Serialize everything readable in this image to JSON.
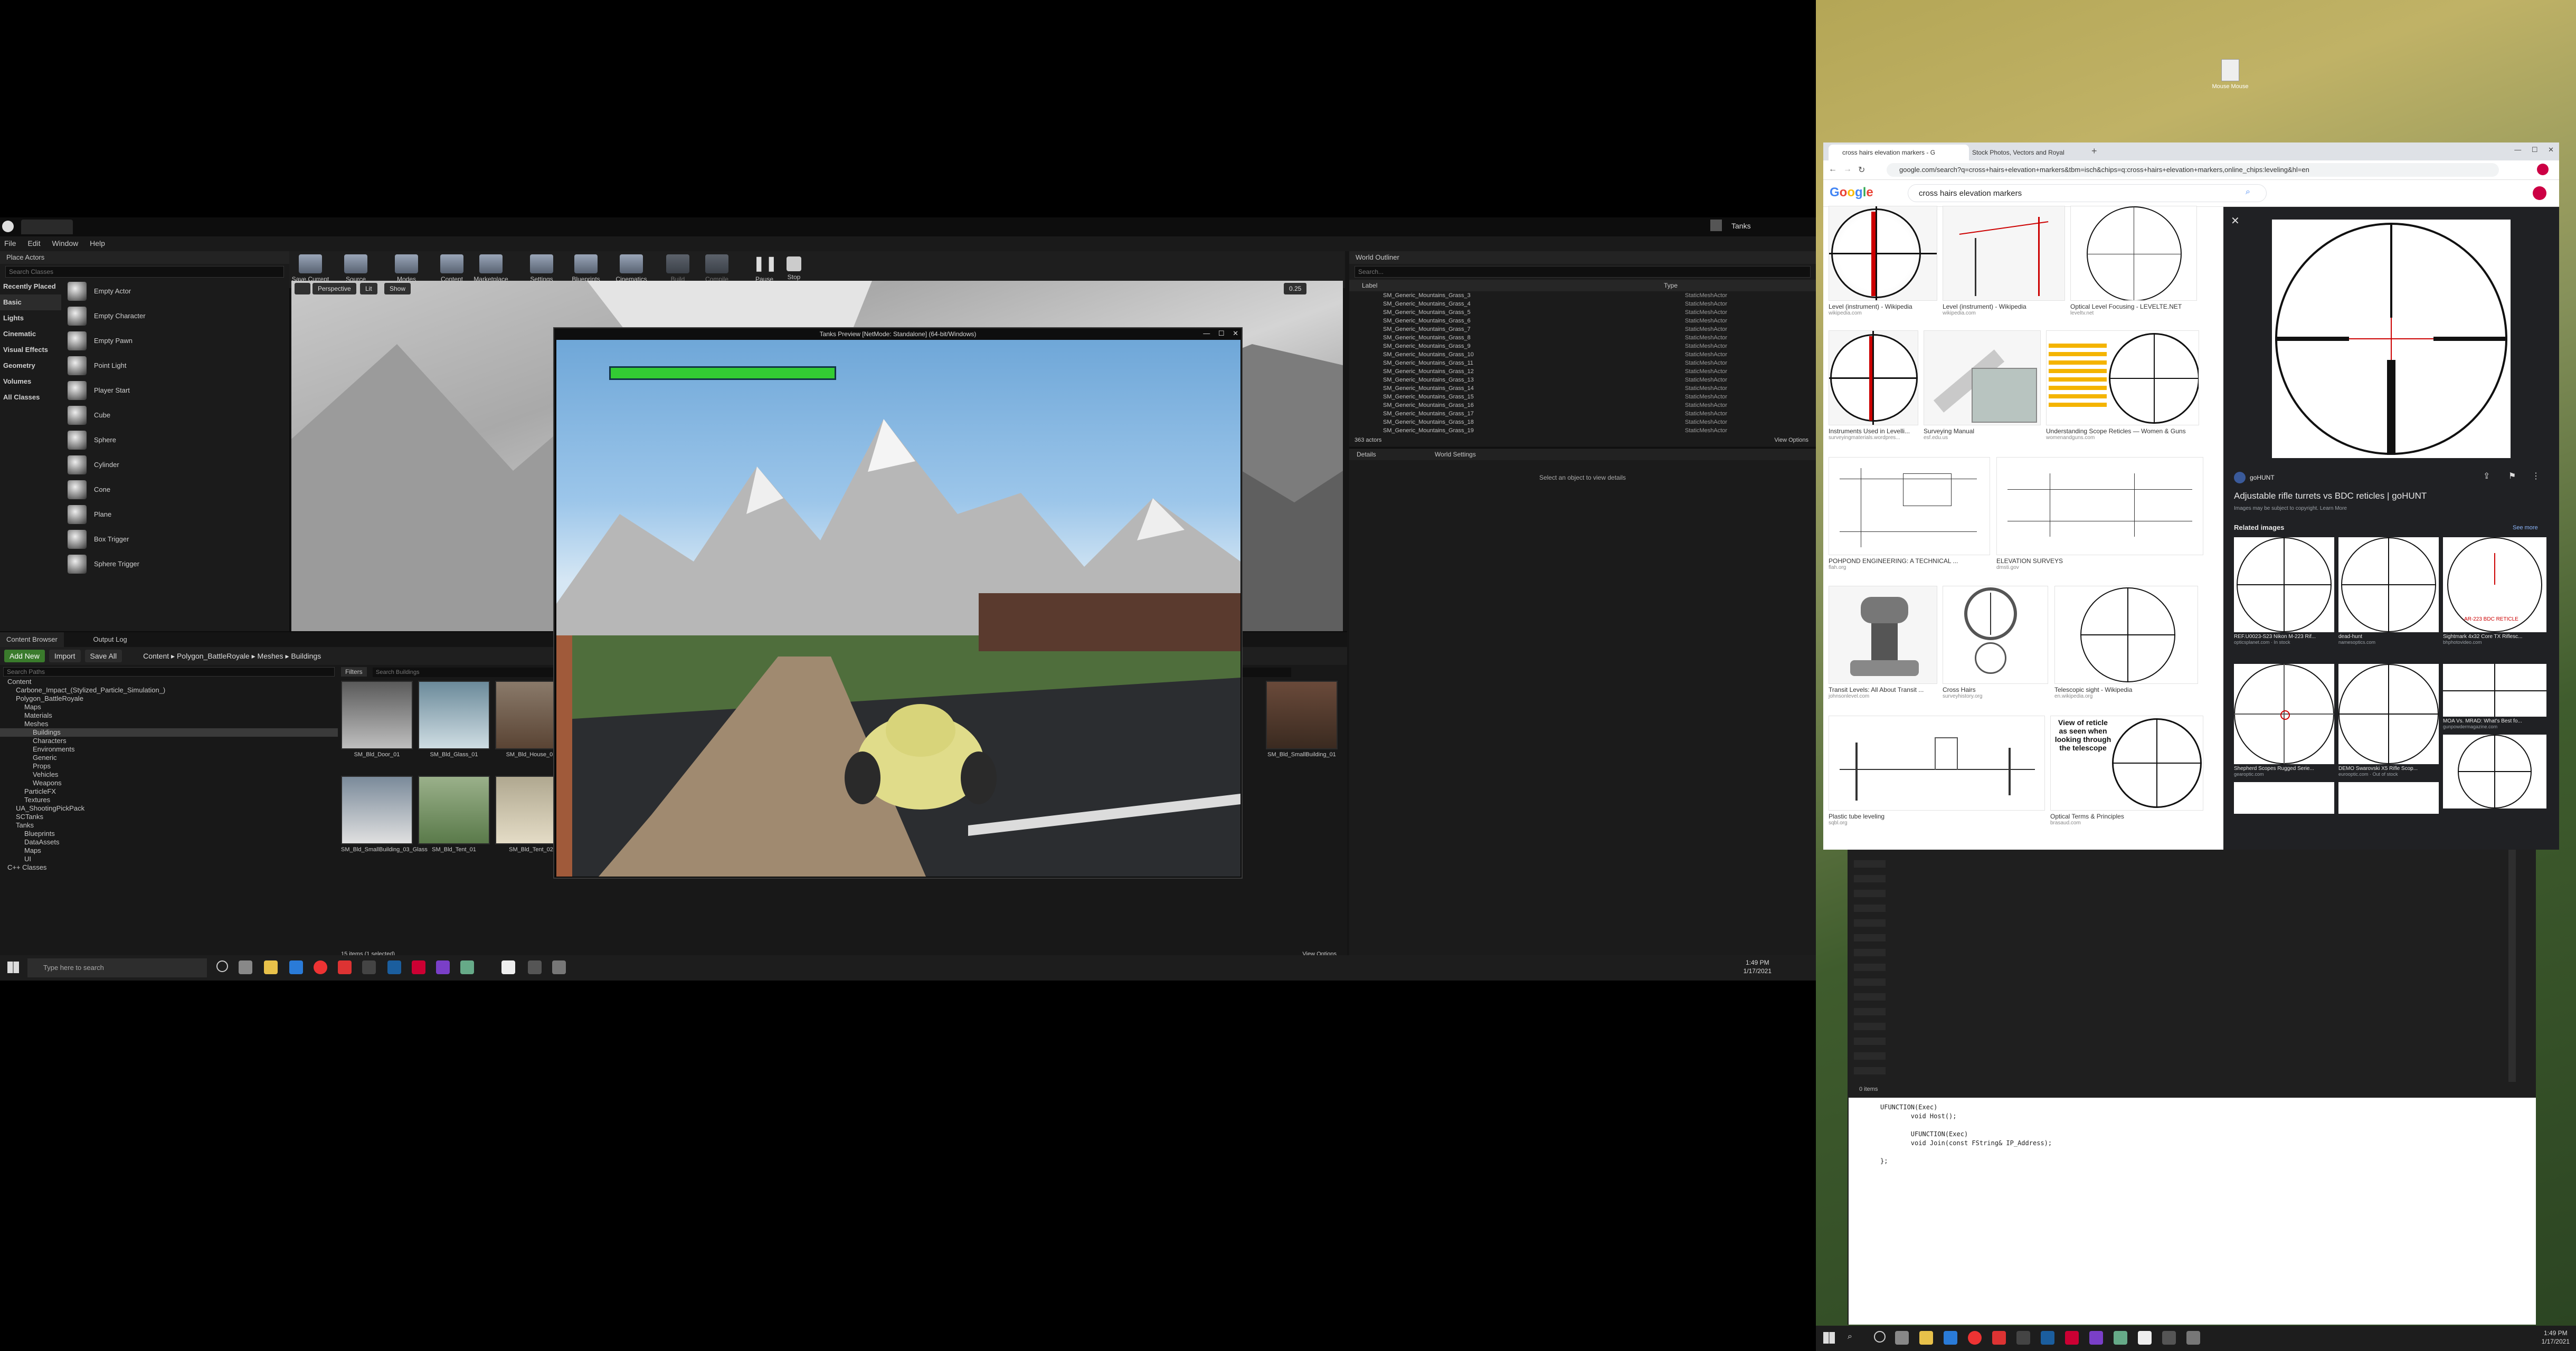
{
  "editor": {
    "title_tab": "Tanks",
    "project_tab": "Tanks",
    "menu": [
      "File",
      "Edit",
      "Window",
      "Help"
    ],
    "place_actors": {
      "header": "Place Actors",
      "search_placeholder": "Search Classes",
      "categories": [
        "Recently Placed",
        "Basic",
        "Lights",
        "Cinematic",
        "Visual Effects",
        "Geometry",
        "Volumes",
        "All Classes"
      ],
      "actors": [
        "Empty Actor",
        "Empty Character",
        "Empty Pawn",
        "Point Light",
        "Player Start",
        "Cube",
        "Sphere",
        "Cylinder",
        "Cone",
        "Plane",
        "Box Trigger",
        "Sphere Trigger"
      ]
    },
    "toolbar": [
      "Save Current",
      "Source Control",
      "Modes",
      "Content",
      "Marketplace",
      "Settings",
      "Blueprints",
      "Cinematics",
      "Build",
      "Compile",
      "Pause",
      "Stop"
    ],
    "viewport": {
      "perspective": "Perspective",
      "lit": "Lit",
      "show": "Show",
      "grid": "0.25"
    },
    "outliner": {
      "header": "World Outliner",
      "search_placeholder": "Search...",
      "col_label": "Label",
      "col_type": "Type",
      "rows": [
        "SM_Generic_Mountains_Grass_3",
        "SM_Generic_Mountains_Grass_4",
        "SM_Generic_Mountains_Grass_5",
        "SM_Generic_Mountains_Grass_6",
        "SM_Generic_Mountains_Grass_7",
        "SM_Generic_Mountains_Grass_8",
        "SM_Generic_Mountains_Grass_9",
        "SM_Generic_Mountains_Grass_10",
        "SM_Generic_Mountains_Grass_11",
        "SM_Generic_Mountains_Grass_12",
        "SM_Generic_Mountains_Grass_13",
        "SM_Generic_Mountains_Grass_14",
        "SM_Generic_Mountains_Grass_15",
        "SM_Generic_Mountains_Grass_16",
        "SM_Generic_Mountains_Grass_17",
        "SM_Generic_Mountains_Grass_18",
        "SM_Generic_Mountains_Grass_19"
      ],
      "row_type": "StaticMeshActor",
      "actor_count": "363 actors",
      "view_options": "View Options"
    },
    "details": {
      "tab": "Details",
      "world_tab": "World Settings",
      "empty_text": "Select an object to view details"
    },
    "content_browser": {
      "tab": "Content Browser",
      "output_tab": "Output Log",
      "add_new": "Add New",
      "import": "Import",
      "save_all": "Save All",
      "path": [
        "Content",
        "Polygon_BattleRoyale",
        "Meshes",
        "Buildings"
      ],
      "search_paths": "Search Paths",
      "filters": "Filters",
      "search_assets": "Search Buildings",
      "tree": [
        "Content",
        "Carbone_Impact_(Stylized_Particle_Simulation_)",
        "Polygon_BattleRoyale",
        "Maps",
        "Materials",
        "Meshes",
        "Buildings",
        "Characters",
        "Environments",
        "Generic",
        "Props",
        "Vehicles",
        "Weapons",
        "ParticleFX",
        "Textures",
        "UA_ShootingPickPack",
        "SCTanks",
        "Tanks",
        "Blueprints",
        "DataAssets",
        "Maps",
        "UI",
        "C++ Classes"
      ],
      "assets": [
        "SM_Bld_Door_01",
        "SM_Bld_Glass_01",
        "SM_Bld_House_01",
        "SM_Bld_SmallBuilding_01",
        "SM_Bld_SmallBuilding_03_Glass",
        "SM_Bld_Tent_01",
        "SM_Bld_Tent_02"
      ],
      "status": "15 items (1 selected)",
      "view_options": "View Options"
    },
    "pie_title": "Tanks Preview [NetMode: Standalone] (64-bit/Windows)"
  },
  "taskbar_left": {
    "search": "Type here to search",
    "time": "1:49 PM",
    "date": "1/17/2021"
  },
  "desktop_icon_label": "Mouse Mouse",
  "browser": {
    "tabs": [
      "cross hairs elevation markers - G",
      "Stock Photos, Vectors and Royal"
    ],
    "url": "google.com/search?q=cross+hairs+elevation+markers&tbm=isch&chips=q:cross+hairs+elevation+markers,online_chips:leveling&hl=en",
    "query": "cross hairs elevation markers",
    "results": [
      {
        "t": "Level (instrument) - Wikipedia",
        "s": "wikipedia.com"
      },
      {
        "t": "Level (instrument) - Wikipedia",
        "s": "wikipedia.com"
      },
      {
        "t": "Optical Level Focusing - LEVELTE.NET",
        "s": "leveltv.net"
      },
      {
        "t": "Instruments Used in Levelli...",
        "s": "surveyingmaterials.wordpres..."
      },
      {
        "t": "Surveying Manual",
        "s": "esf.edu.us"
      },
      {
        "t": "Understanding Scope Reticles — Women & Guns",
        "s": "womenandguns.com"
      },
      {
        "t": "POHPOND ENGINEERING: A TECHNICAL ...",
        "s": "flah.org"
      },
      {
        "t": "ELEVATION SURVEYS",
        "s": "dmsti.gov"
      },
      {
        "t": "Transit Levels: All About Transit ...",
        "s": "johnsonlevel.com"
      },
      {
        "t": "Cross Hairs",
        "s": "surveyhistory.org"
      },
      {
        "t": "Telescopic sight - Wikipedia",
        "s": "en.wikipedia.org"
      },
      {
        "t": "Plastic tube leveling",
        "s": "sqbl.org"
      },
      {
        "t": "Optical Terms & Principles",
        "s": "brasaud.com"
      }
    ],
    "scope_note": "View of reticle as seen when looking through the telescope",
    "preview": {
      "source": "goHUNT",
      "title": "Adjustable rifle turrets vs BDC reticles | goHUNT",
      "copyright": "Images may be subject to copyright. Learn More",
      "related": "Related images",
      "see_more": "See more",
      "related_items": [
        {
          "t": "REF.U0023-S23 Nikon M-223 Rif...",
          "s": "opticsplanet.com · In stock"
        },
        {
          "t": "dead-hunt",
          "s": "namesoptics.com"
        },
        {
          "t": "Sightmark 4x32 Core TX Riflesc...",
          "s": "bhphotovideo.com"
        },
        {
          "t": "Shepherd Scopes Rugged Serie...",
          "s": "gearoptic.com"
        },
        {
          "t": "DEMO Swarovski X5 Rifle Scop...",
          "s": "eurooptic.com · Out of stock"
        },
        {
          "t": "MOA Vs. MRAD: What's Best fo...",
          "s": "gunpowdermagazine.com"
        }
      ],
      "reticle_caption": "AR-223 BDC RETICLE"
    }
  },
  "code_editor": {
    "status": "0 items",
    "code": "UFUNCTION(Exec)\n        void Host();\n\n        UFUNCTION(Exec)\n        void Join(const FString& IP_Address);\n\n};"
  },
  "taskbar_right": {
    "time": "1:49 PM",
    "date": "1/17/2021"
  }
}
